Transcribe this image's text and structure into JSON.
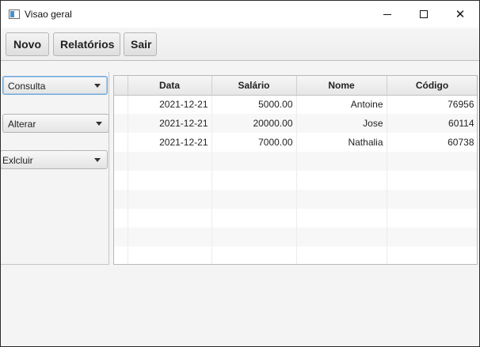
{
  "window": {
    "title": "Visao geral",
    "icon": "app-window-icon"
  },
  "toolbar": {
    "novo_label": "Novo",
    "relatorios_label": "Relatórios",
    "sair_label": "Sair"
  },
  "sidebar": {
    "consulta_value": "Consulta",
    "alterar_value": "Alterar",
    "excluir_value": "Exlcluir"
  },
  "table": {
    "columns": [
      "Data",
      "Salário",
      "Nome",
      "Código"
    ],
    "rows": [
      [
        "2021-12-21",
        "5000.00",
        "Antoine",
        "76956"
      ],
      [
        "2021-12-21",
        "20000.00",
        "Jose",
        "60114"
      ],
      [
        "2021-12-21",
        "7000.00",
        "Nathalia",
        "60738"
      ]
    ],
    "empty_rows": 6
  }
}
